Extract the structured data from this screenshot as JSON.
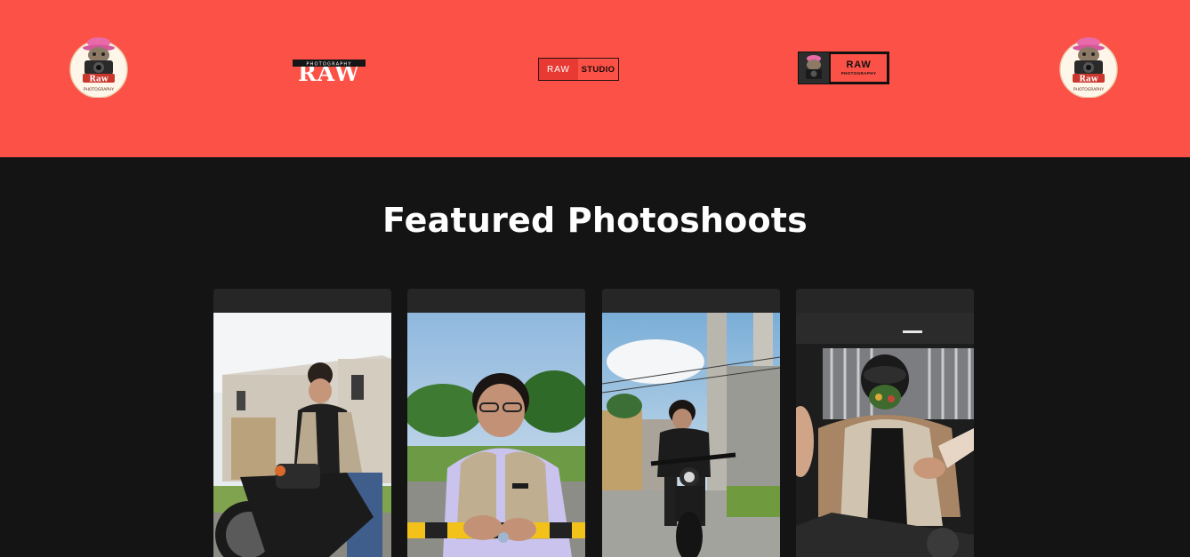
{
  "banner": {
    "background_color": "#fb5146",
    "logos": [
      {
        "name": "raw-photography-round-logo",
        "title": "Raw",
        "subtitle": "PHOTOGRAPHY"
      },
      {
        "name": "raw-photography-wordmark",
        "title": "RAW",
        "subtitle": "PHOTOGRAPHY"
      },
      {
        "name": "raw-studio-logo",
        "left_text": "RAW",
        "right_text": "STUDIO"
      },
      {
        "name": "raw-photography-badge",
        "title": "RAW",
        "subtitle": "PHOTOGRAPHY"
      },
      {
        "name": "raw-photography-round-logo",
        "title": "Raw",
        "subtitle": "PHOTOGRAPHY"
      }
    ]
  },
  "featured": {
    "heading": "Featured Photoshoots",
    "photos": [
      {
        "name": "photo-man-on-motorcycle-house"
      },
      {
        "name": "photo-man-in-vest-leaning"
      },
      {
        "name": "photo-rider-on-street"
      },
      {
        "name": "photo-rider-with-helmet"
      }
    ]
  }
}
